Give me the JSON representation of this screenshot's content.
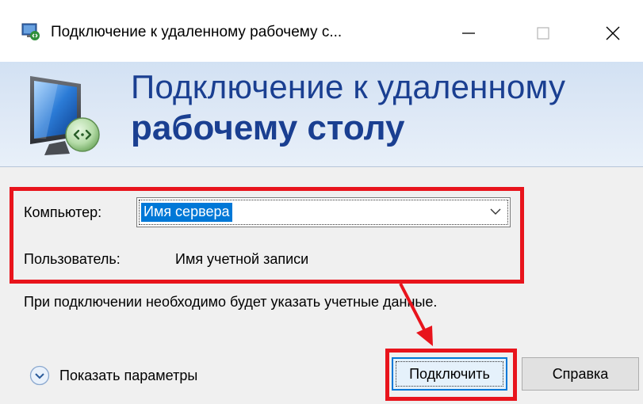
{
  "window": {
    "title": "Подключение к удаленному рабочему с...",
    "controls": {
      "minimize_icon": "minimize-icon",
      "maximize_icon": "maximize-icon",
      "close_icon": "close-icon"
    }
  },
  "banner": {
    "line1": "Подключение к удаленному",
    "line2": "рабочему столу",
    "icon": "remote-desktop-monitor-icon"
  },
  "form": {
    "computer_label": "Компьютер:",
    "computer_value": "Имя сервера",
    "user_label": "Пользователь:",
    "user_value": "Имя учетной записи"
  },
  "info_text": "При подключении необходимо будет указать учетные данные.",
  "footer": {
    "options_label": "Показать параметры",
    "connect_label": "Подключить",
    "help_label": "Справка"
  },
  "colors": {
    "annotation": "#e8141c",
    "banner_text": "#1a3f91",
    "selection": "#0078d7"
  }
}
